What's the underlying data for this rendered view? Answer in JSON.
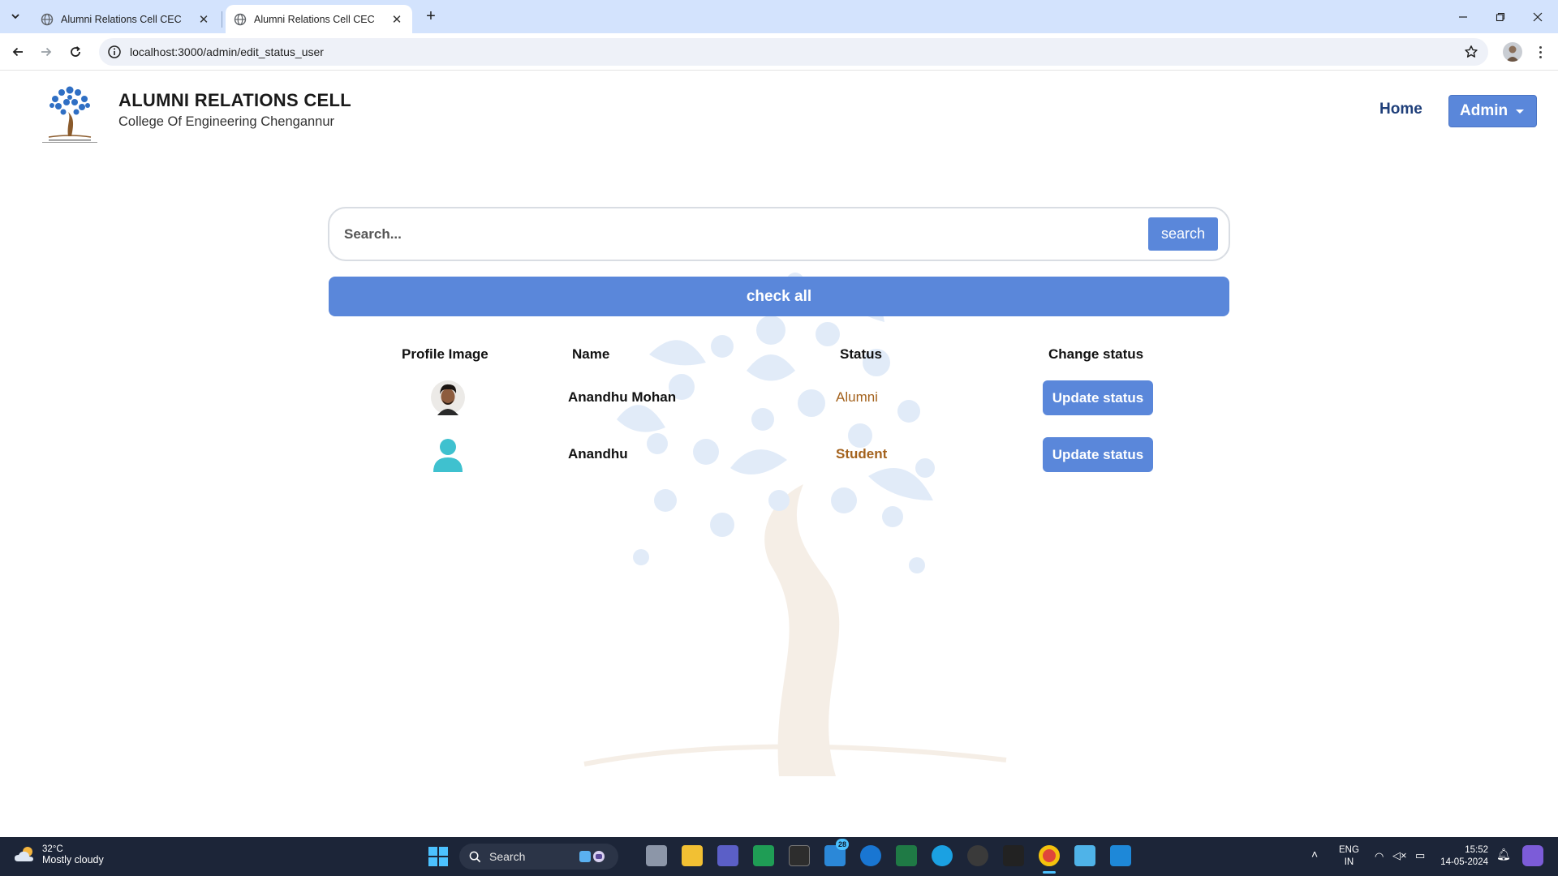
{
  "browser": {
    "tabs": [
      {
        "title": "Alumni Relations Cell CEC",
        "active": false
      },
      {
        "title": "Alumni Relations Cell CEC",
        "active": true
      }
    ],
    "url": "localhost:3000/admin/edit_status_user"
  },
  "navbar": {
    "title": "ALUMNI RELATIONS CELL",
    "subtitle": "College Of Engineering Chengannur",
    "home_label": "Home",
    "admin_label": "Admin"
  },
  "search": {
    "placeholder": "Search...",
    "button_label": "search"
  },
  "check_all_label": "check all",
  "table": {
    "headers": [
      "Profile Image",
      "Name",
      "Status",
      "Change status"
    ],
    "rows": [
      {
        "name": "Anandhu Mohan",
        "status": "Alumni",
        "action": "Update status",
        "avatar": "photo-avatar"
      },
      {
        "name": "Anandhu",
        "status": "Student",
        "action": "Update status",
        "avatar": "default-user-icon"
      }
    ]
  },
  "colors": {
    "accent": "#5a87da",
    "status_text": "#a4621d",
    "nav_link": "#1f3f7a"
  },
  "taskbar": {
    "weather_temp": "32°C",
    "weather_condition": "Mostly cloudy",
    "search_label": "Search",
    "mail_badge": "28",
    "lang_line1": "ENG",
    "lang_line2": "IN",
    "time": "15:52",
    "date": "14-05-2024"
  }
}
